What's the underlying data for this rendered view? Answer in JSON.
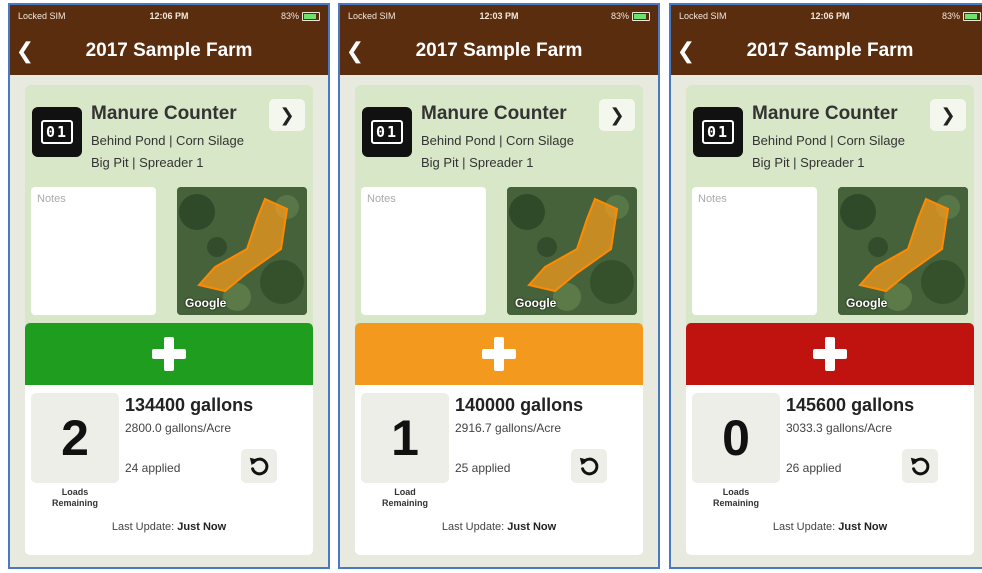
{
  "colors": {
    "nav_brown": "#5b2d0f",
    "card_green_bg": "#d8e7c7",
    "frame_blue": "#4a78c4"
  },
  "screens": [
    {
      "status": {
        "carrier": "Locked SIM",
        "time": "12:06 PM",
        "battery": "83%"
      },
      "nav": {
        "back_icon": "chevron-left-icon",
        "title": "2017 Sample Farm"
      },
      "counter": {
        "icon_digits": "01",
        "title": "Manure Counter",
        "location": "Behind Pond | Corn Silage",
        "source": "Big Pit | Spreader 1",
        "notes_placeholder": "Notes",
        "map_label": "Google",
        "add_button_color": "#1f9d1f",
        "loads_remaining": "2",
        "loads_label_1": "Loads",
        "loads_label_2": "Remaining",
        "gallons": "134400 gallons",
        "rate": "2800.0 gallons/Acre",
        "applied": "24 applied",
        "last_update_prefix": "Last Update:",
        "last_update_value": "Just Now"
      }
    },
    {
      "status": {
        "carrier": "Locked SIM",
        "time": "12:03 PM",
        "battery": "83%"
      },
      "nav": {
        "back_icon": "chevron-left-icon",
        "title": "2017 Sample Farm"
      },
      "counter": {
        "icon_digits": "01",
        "title": "Manure Counter",
        "location": "Behind Pond | Corn Silage",
        "source": "Big Pit | Spreader 1",
        "notes_placeholder": "Notes",
        "map_label": "Google",
        "add_button_color": "#f39a1e",
        "loads_remaining": "1",
        "loads_label_1": "Load",
        "loads_label_2": "Remaining",
        "gallons": "140000 gallons",
        "rate": "2916.7 gallons/Acre",
        "applied": "25 applied",
        "last_update_prefix": "Last Update:",
        "last_update_value": "Just Now"
      }
    },
    {
      "status": {
        "carrier": "Locked SIM",
        "time": "12:06 PM",
        "battery": "83%"
      },
      "nav": {
        "back_icon": "chevron-left-icon",
        "title": "2017 Sample Farm"
      },
      "counter": {
        "icon_digits": "01",
        "title": "Manure Counter",
        "location": "Behind Pond | Corn Silage",
        "source": "Big Pit | Spreader 1",
        "notes_placeholder": "Notes",
        "map_label": "Google",
        "add_button_color": "#c0120f",
        "loads_remaining": "0",
        "loads_label_1": "Loads",
        "loads_label_2": "Remaining",
        "gallons": "145600 gallons",
        "rate": "3033.3 gallons/Acre",
        "applied": "26 applied",
        "last_update_prefix": "Last Update:",
        "last_update_value": "Just Now"
      }
    }
  ]
}
